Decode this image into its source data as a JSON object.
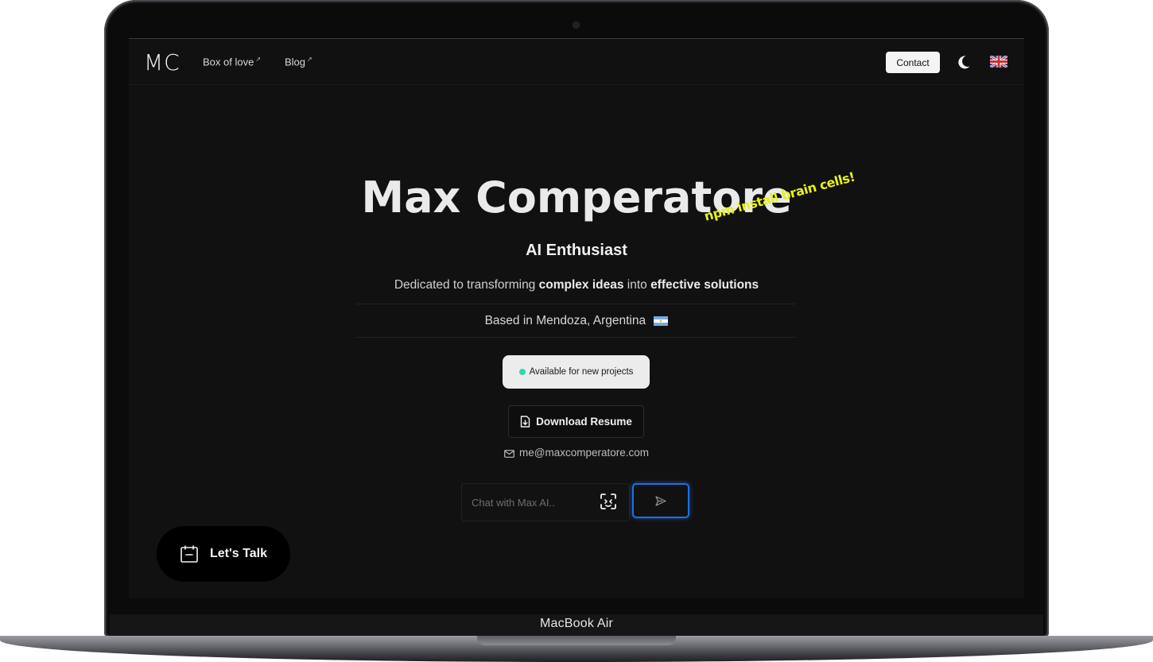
{
  "device": {
    "label": "MacBook Air"
  },
  "nav": {
    "logo": "MC",
    "links": [
      {
        "label": "Box of love",
        "arrow": "↗"
      },
      {
        "label": "Blog",
        "arrow": "↗"
      }
    ],
    "contact_label": "Contact",
    "theme_icon": "moon-icon",
    "language_icon": "uk-flag-icon"
  },
  "hero": {
    "name": "Max Comperatore",
    "sticker": "npm install brain cells!",
    "role": "AI Enthusiast",
    "tagline_pre": "Dedicated to transforming ",
    "tagline_bold1": "complex ideas",
    "tagline_mid": " into ",
    "tagline_bold2": "effective solutions",
    "location": "Based in Mendoza, Argentina"
  },
  "status": {
    "label": "Available for new projects",
    "color": "#35d4b0"
  },
  "resume": {
    "label": "Download Resume"
  },
  "contact": {
    "email": "me@maxcomperatore.com"
  },
  "chat": {
    "placeholder": "Chat with Max AI..",
    "accent": "#1f6fe0"
  },
  "cta": {
    "label": "Let's Talk"
  }
}
